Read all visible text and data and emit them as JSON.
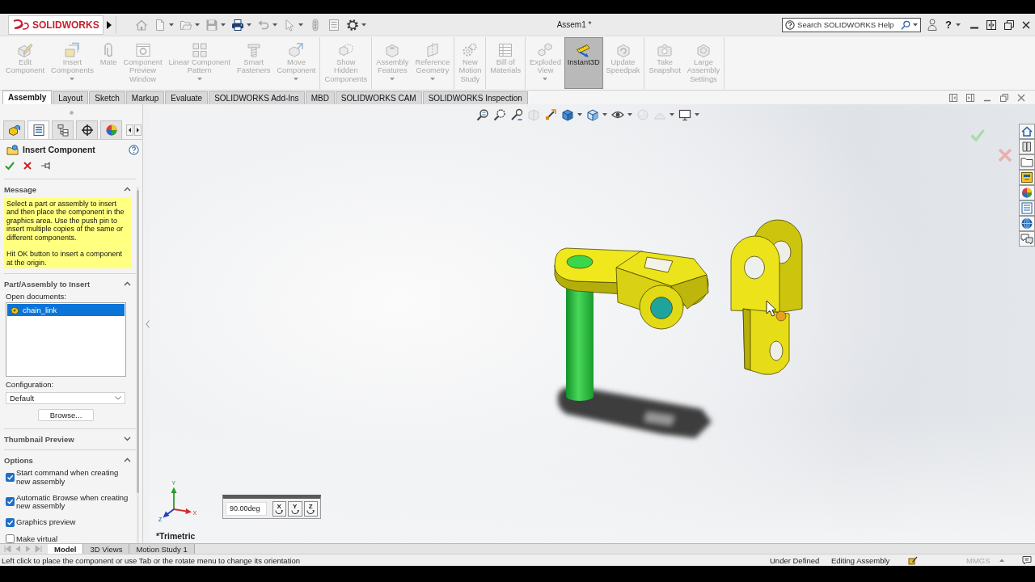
{
  "title_bar": {
    "logo": "SOLIDWORKS",
    "quick_access": [
      {
        "kind": "home",
        "disabled": true,
        "dropdown": false
      },
      {
        "kind": "new",
        "disabled": true,
        "dropdown": true
      },
      {
        "kind": "open",
        "disabled": true,
        "dropdown": true
      },
      {
        "kind": "save",
        "disabled": true,
        "dropdown": true
      },
      {
        "kind": "print",
        "disabled": false,
        "dropdown": true
      },
      {
        "kind": "undo",
        "disabled": true,
        "dropdown": true
      },
      {
        "kind": "select",
        "disabled": true,
        "dropdown": true
      },
      {
        "kind": "rebuild",
        "disabled": true,
        "dropdown": false
      },
      {
        "kind": "properties",
        "disabled": true,
        "dropdown": false
      },
      {
        "kind": "options",
        "disabled": false,
        "dropdown": true
      }
    ],
    "document_title": "Assem1 *",
    "search": {
      "placeholder": "Search SOLIDWORKS Help"
    },
    "help_menu": "?"
  },
  "ribbon": {
    "groups": [
      {
        "commands": [
          {
            "kind": "edit",
            "label": "Edit\nComponent",
            "disabled": true,
            "dropdown": false,
            "selected": false
          },
          {
            "kind": "insert",
            "label": "Insert\nComponents",
            "disabled": true,
            "dropdown": true,
            "selected": false
          },
          {
            "kind": "mate",
            "label": "Mate",
            "disabled": true,
            "dropdown": false,
            "selected": false
          },
          {
            "kind": "preview",
            "label": "Component\nPreview\nWindow",
            "disabled": true,
            "dropdown": false,
            "selected": false
          },
          {
            "kind": "pattern",
            "label": "Linear Component\nPattern",
            "disabled": true,
            "dropdown": true,
            "selected": false
          },
          {
            "kind": "fastener",
            "label": "Smart\nFasteners",
            "disabled": true,
            "dropdown": false,
            "selected": false
          },
          {
            "kind": "move",
            "label": "Move\nComponent",
            "disabled": true,
            "dropdown": true,
            "selected": false
          }
        ]
      },
      {
        "commands": [
          {
            "kind": "show-hidden",
            "label": "Show\nHidden\nComponents",
            "disabled": true,
            "dropdown": false,
            "selected": false
          }
        ]
      },
      {
        "commands": [
          {
            "kind": "features",
            "label": "Assembly\nFeatures",
            "disabled": true,
            "dropdown": true,
            "selected": false
          },
          {
            "kind": "reference",
            "label": "Reference\nGeometry",
            "disabled": true,
            "dropdown": true,
            "selected": false
          }
        ]
      },
      {
        "commands": [
          {
            "kind": "motion",
            "label": "New\nMotion\nStudy",
            "disabled": true,
            "dropdown": false,
            "selected": false
          }
        ]
      },
      {
        "commands": [
          {
            "kind": "bom",
            "label": "Bill of\nMaterials",
            "disabled": true,
            "dropdown": false,
            "selected": false
          }
        ]
      },
      {
        "commands": [
          {
            "kind": "explode",
            "label": "Exploded\nView",
            "disabled": true,
            "dropdown": true,
            "selected": false
          },
          {
            "kind": "instant3d",
            "label": "Instant3D",
            "disabled": false,
            "dropdown": false,
            "selected": true
          },
          {
            "kind": "speedpak",
            "label": "Update\nSpeedpak",
            "disabled": true,
            "dropdown": false,
            "selected": false
          }
        ]
      },
      {
        "commands": [
          {
            "kind": "snapshot",
            "label": "Take\nSnapshot",
            "disabled": true,
            "dropdown": false,
            "selected": false
          },
          {
            "kind": "large",
            "label": "Large\nAssembly\nSettings",
            "disabled": true,
            "dropdown": false,
            "selected": false
          }
        ]
      }
    ]
  },
  "tabs": [
    {
      "label": "Assembly",
      "selected": true
    },
    {
      "label": "Layout",
      "selected": false
    },
    {
      "label": "Sketch",
      "selected": false
    },
    {
      "label": "Markup",
      "selected": false
    },
    {
      "label": "Evaluate",
      "selected": false
    },
    {
      "label": "SOLIDWORKS Add-Ins",
      "selected": false
    },
    {
      "label": "MBD",
      "selected": false
    },
    {
      "label": "SOLIDWORKS CAM",
      "selected": false
    },
    {
      "label": "SOLIDWORKS Inspection",
      "selected": false
    }
  ],
  "panel_tabs": [
    {
      "kind": "feature-tree",
      "selected": false
    },
    {
      "kind": "property-manager",
      "selected": true
    },
    {
      "kind": "configuration",
      "selected": false
    },
    {
      "kind": "dimxpert",
      "selected": false
    },
    {
      "kind": "display",
      "selected": false
    }
  ],
  "property_manager": {
    "title": "Insert Component",
    "sections": [
      {
        "kind": "message",
        "title": "Message",
        "expanded": true,
        "paragraphs": [
          "Select a part or assembly to insert and then place the component in the graphics area. Use the push pin to insert multiple copies of the same or different components.",
          "Hit OK button to insert a component at the origin."
        ]
      },
      {
        "kind": "insert",
        "title": "Part/Assembly to Insert",
        "expanded": true,
        "list_label": "Open documents:",
        "documents": [
          {
            "name": "chain_link",
            "selected": true
          }
        ],
        "config_label": "Configuration:",
        "configuration": "Default",
        "browse_button": "Browse..."
      },
      {
        "kind": "preview",
        "title": "Thumbnail Preview",
        "expanded": false
      },
      {
        "kind": "options",
        "title": "Options",
        "expanded": true,
        "options": [
          {
            "label": "Start command when creating new assembly",
            "checked": true
          },
          {
            "label": "Automatic Browse when creating new assembly",
            "checked": true
          },
          {
            "label": "Graphics preview",
            "checked": true
          },
          {
            "label": "Make virtual",
            "checked": false
          }
        ]
      }
    ]
  },
  "graphics": {
    "heads_up_toolbar": [
      {
        "kind": "zoom-fit",
        "disabled": false,
        "dropdown": false
      },
      {
        "kind": "zoom-area",
        "disabled": false,
        "dropdown": false
      },
      {
        "kind": "previous",
        "disabled": false,
        "dropdown": false
      },
      {
        "kind": "section",
        "disabled": true,
        "dropdown": false
      },
      {
        "kind": "annotation",
        "disabled": false,
        "dropdown": false
      },
      {
        "kind": "display-style",
        "disabled": false,
        "dropdown": true
      },
      {
        "kind": "orientation",
        "disabled": false,
        "dropdown": true
      },
      {
        "kind": "hide-show",
        "disabled": false,
        "dropdown": true
      },
      {
        "kind": "appearance",
        "disabled": true,
        "dropdown": false
      },
      {
        "kind": "scene",
        "disabled": true,
        "dropdown": true
      },
      {
        "kind": "settings",
        "disabled": false,
        "dropdown": true
      }
    ],
    "triad": {
      "x": "X",
      "y": "Y",
      "z": "Z"
    },
    "rotate_box": {
      "angle": "90.00deg",
      "axes": [
        "X",
        "Y",
        "Z"
      ]
    },
    "orientation": "*Trimetric"
  },
  "model_tabs": {
    "scroll_disabled": true,
    "tabs": [
      {
        "label": "Model",
        "selected": true
      },
      {
        "label": "3D Views",
        "selected": false
      },
      {
        "label": "Motion Study 1",
        "selected": false
      }
    ]
  },
  "status_bar": {
    "message": "Left click to place the component or use Tab or the rotate menu to change its orientation",
    "state": "Under Defined",
    "mode": "Editing Assembly",
    "units": {
      "label": "MMGS",
      "disabled": true
    }
  }
}
